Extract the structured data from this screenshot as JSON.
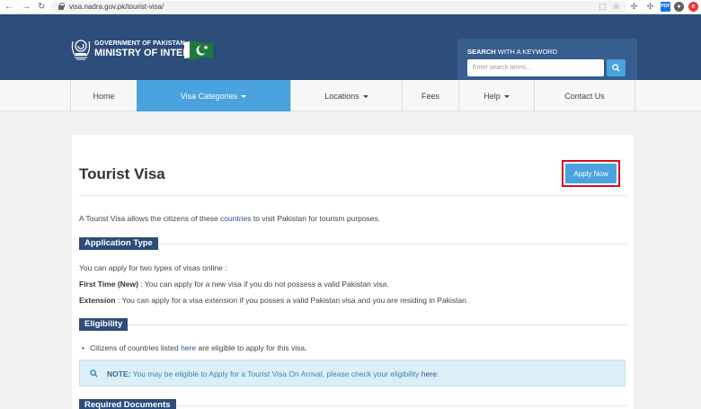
{
  "browser": {
    "url": "visa.nadra.gov.pk/tourist-visa/",
    "back_glyph": "←",
    "forward_glyph": "→",
    "reload_glyph": "↻",
    "ext_translate": "⬚",
    "ext_star": "☆",
    "ext_puzzle": "✣",
    "ext_pdf": "PDF",
    "ext_red": "e",
    "ext_avatar": "●",
    "ext_menu": "⋮"
  },
  "header": {
    "org_line1": "GOVERNMENT OF PAKISTAN",
    "org_line2": "MINISTRY OF INTERIOR",
    "search_label_bold": "SEARCH",
    "search_label_rest": " WITH A KEYWORD",
    "search_placeholder": "Enter search terms...",
    "colors": {
      "header_bg": "#2d4d7a",
      "search_panel": "#385d8f",
      "accent": "#4aa3df"
    }
  },
  "nav": {
    "items": [
      {
        "label": "Home"
      },
      {
        "label": "Visa Categories",
        "active": true,
        "has_caret": true
      },
      {
        "label": "Locations",
        "has_caret": true
      },
      {
        "label": "Fees"
      },
      {
        "label": "Help",
        "has_caret": true
      },
      {
        "label": "Contact Us"
      }
    ]
  },
  "content": {
    "title": "Tourist Visa",
    "apply_label": "Apply Now",
    "intro_before": "A Tourist Visa allows the citizens of these ",
    "intro_link": "countries",
    "intro_after": " to visit Pakistan for tourism purposes.",
    "application_type_heading": "Application Type",
    "app_types_intro": "You can apply for two types of visas online :",
    "first_time_label": "First Time (New)",
    "first_time_text": " : You can apply for a new visa if you do not possess a valid Pakistan visa.",
    "extension_label": "Extension",
    "extension_text": " : You can apply for a visa extension if you posses a valid Pakistan visa and you are residing in Pakistan.",
    "eligibility_heading": "Eligibility",
    "eligibility_before": "Citizens of countries listed ",
    "eligibility_link": "here",
    "eligibility_after": " are eligible to apply for this visa.",
    "note_label": "NOTE:",
    "note_text": " You may be eligible to Apply for a Tourist Visa On Arrival, please check your eligibility ",
    "note_link": "here",
    "note_end": ":",
    "required_docs_heading": "Required Documents"
  }
}
